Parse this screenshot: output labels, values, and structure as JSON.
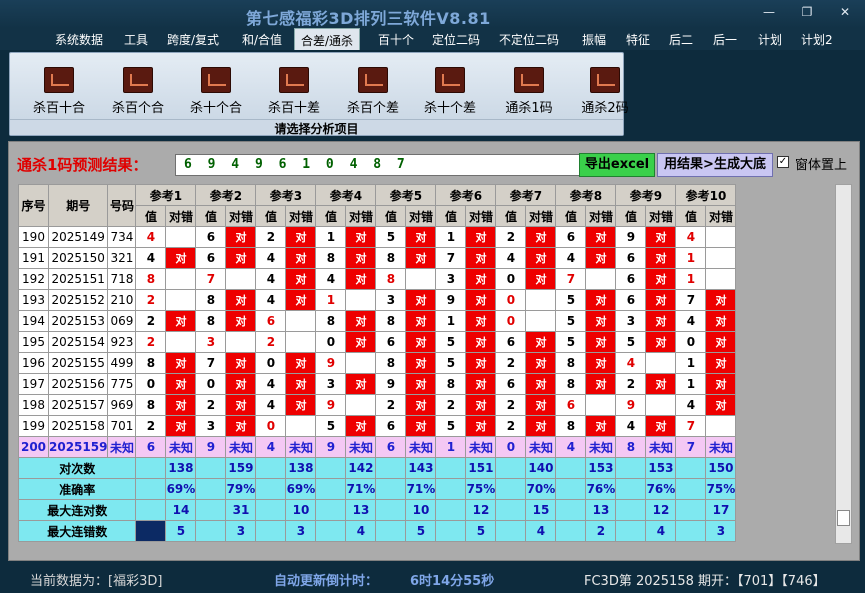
{
  "window": {
    "title": "第七感福彩3D排列三软件V8.81"
  },
  "menu": [
    "系统数据",
    "工具",
    "跨度/复式",
    "和/合值",
    "合差/通杀",
    "百十个",
    "定位二码",
    "不定位二码",
    "振幅",
    "特征",
    "后二",
    "后一",
    "计划",
    "计划2"
  ],
  "menu_active": 4,
  "ribbon": {
    "caption": "请选择分析项目",
    "buttons": [
      "杀百十合",
      "杀百个合",
      "杀十个合",
      "杀百十差",
      "杀百个差",
      "杀十个差",
      "通杀1码",
      "通杀2码"
    ]
  },
  "prediction": {
    "label": "通杀1码预测结果：",
    "value": "6 9 4 9 6 1 0 4 8 7",
    "export_label": "导出excel",
    "compound_label": "用结果>生成大底",
    "ontop_label": "窗体置上",
    "ontop_checked": "✓"
  },
  "table": {
    "headers": {
      "seq": "序号",
      "issue": "期号",
      "code": "号码",
      "ref_prefix": "参考",
      "val": "值",
      "hit": "对错"
    },
    "refs": [
      "参考1",
      "参考2",
      "参考3",
      "参考4",
      "参考5",
      "参考6",
      "参考7",
      "参考8",
      "参考9",
      "参考10"
    ],
    "rows": [
      {
        "seq": "190",
        "issue": "2025149",
        "code": "734",
        "cells": [
          [
            "4",
            "",
            1
          ],
          [
            "6",
            "对",
            0
          ],
          [
            "2",
            "对",
            0
          ],
          [
            "1",
            "对",
            0
          ],
          [
            "5",
            "对",
            0
          ],
          [
            "1",
            "对",
            0
          ],
          [
            "2",
            "对",
            0
          ],
          [
            "6",
            "对",
            0
          ],
          [
            "9",
            "对",
            0
          ],
          [
            "4",
            "",
            1
          ]
        ]
      },
      {
        "seq": "191",
        "issue": "2025150",
        "code": "321",
        "cells": [
          [
            "4",
            "对",
            0
          ],
          [
            "6",
            "对",
            0
          ],
          [
            "4",
            "对",
            0
          ],
          [
            "8",
            "对",
            0
          ],
          [
            "8",
            "对",
            0
          ],
          [
            "7",
            "对",
            0
          ],
          [
            "4",
            "对",
            0
          ],
          [
            "4",
            "对",
            0
          ],
          [
            "6",
            "对",
            0
          ],
          [
            "1",
            "",
            1
          ]
        ]
      },
      {
        "seq": "192",
        "issue": "2025151",
        "code": "718",
        "cells": [
          [
            "8",
            "",
            1
          ],
          [
            "7",
            "",
            1
          ],
          [
            "4",
            "对",
            0
          ],
          [
            "4",
            "对",
            0
          ],
          [
            "8",
            "",
            1
          ],
          [
            "3",
            "对",
            0
          ],
          [
            "0",
            "对",
            0
          ],
          [
            "7",
            "",
            1
          ],
          [
            "6",
            "对",
            0
          ],
          [
            "1",
            "",
            1
          ]
        ]
      },
      {
        "seq": "193",
        "issue": "2025152",
        "code": "210",
        "cells": [
          [
            "2",
            "",
            1
          ],
          [
            "8",
            "对",
            0
          ],
          [
            "4",
            "对",
            0
          ],
          [
            "1",
            "",
            1
          ],
          [
            "3",
            "对",
            0
          ],
          [
            "9",
            "对",
            0
          ],
          [
            "0",
            "",
            1
          ],
          [
            "5",
            "对",
            0
          ],
          [
            "6",
            "对",
            0
          ],
          [
            "7",
            "对",
            0
          ]
        ]
      },
      {
        "seq": "194",
        "issue": "2025153",
        "code": "069",
        "cells": [
          [
            "2",
            "对",
            0
          ],
          [
            "8",
            "对",
            0
          ],
          [
            "6",
            "",
            1
          ],
          [
            "8",
            "对",
            0
          ],
          [
            "8",
            "对",
            0
          ],
          [
            "1",
            "对",
            0
          ],
          [
            "0",
            "",
            1
          ],
          [
            "5",
            "对",
            0
          ],
          [
            "3",
            "对",
            0
          ],
          [
            "4",
            "对",
            0
          ]
        ]
      },
      {
        "seq": "195",
        "issue": "2025154",
        "code": "923",
        "cells": [
          [
            "2",
            "",
            1
          ],
          [
            "3",
            "",
            1
          ],
          [
            "2",
            "",
            1
          ],
          [
            "0",
            "对",
            0
          ],
          [
            "6",
            "对",
            0
          ],
          [
            "5",
            "对",
            0
          ],
          [
            "6",
            "对",
            0
          ],
          [
            "5",
            "对",
            0
          ],
          [
            "5",
            "对",
            0
          ],
          [
            "0",
            "对",
            0
          ]
        ]
      },
      {
        "seq": "196",
        "issue": "2025155",
        "code": "499",
        "cells": [
          [
            "8",
            "对",
            0
          ],
          [
            "7",
            "对",
            0
          ],
          [
            "0",
            "对",
            0
          ],
          [
            "9",
            "",
            1
          ],
          [
            "8",
            "对",
            0
          ],
          [
            "5",
            "对",
            0
          ],
          [
            "2",
            "对",
            0
          ],
          [
            "8",
            "对",
            0
          ],
          [
            "4",
            "",
            1
          ],
          [
            "1",
            "对",
            0
          ]
        ]
      },
      {
        "seq": "197",
        "issue": "2025156",
        "code": "775",
        "cells": [
          [
            "0",
            "对",
            0
          ],
          [
            "0",
            "对",
            0
          ],
          [
            "4",
            "对",
            0
          ],
          [
            "3",
            "对",
            0
          ],
          [
            "9",
            "对",
            0
          ],
          [
            "8",
            "对",
            0
          ],
          [
            "6",
            "对",
            0
          ],
          [
            "8",
            "对",
            0
          ],
          [
            "2",
            "对",
            0
          ],
          [
            "1",
            "对",
            0
          ]
        ]
      },
      {
        "seq": "198",
        "issue": "2025157",
        "code": "969",
        "cells": [
          [
            "8",
            "对",
            0
          ],
          [
            "2",
            "对",
            0
          ],
          [
            "4",
            "对",
            0
          ],
          [
            "9",
            "",
            1
          ],
          [
            "2",
            "对",
            0
          ],
          [
            "2",
            "对",
            0
          ],
          [
            "2",
            "对",
            0
          ],
          [
            "6",
            "",
            1
          ],
          [
            "9",
            "",
            1
          ],
          [
            "4",
            "对",
            0
          ]
        ]
      },
      {
        "seq": "199",
        "issue": "2025158",
        "code": "701",
        "cells": [
          [
            "2",
            "对",
            0
          ],
          [
            "3",
            "对",
            0
          ],
          [
            "0",
            "",
            1
          ],
          [
            "5",
            "对",
            0
          ],
          [
            "6",
            "对",
            0
          ],
          [
            "5",
            "对",
            0
          ],
          [
            "2",
            "对",
            0
          ],
          [
            "8",
            "对",
            0
          ],
          [
            "4",
            "对",
            0
          ],
          [
            "7",
            "",
            1
          ]
        ]
      }
    ],
    "pending": {
      "seq": "200",
      "issue": "2025159",
      "code": "未知",
      "values": [
        "6",
        "9",
        "4",
        "9",
        "6",
        "1",
        "0",
        "4",
        "8",
        "7"
      ],
      "status": "未知"
    },
    "stats": [
      {
        "label": "对次数",
        "values": [
          "138",
          "159",
          "138",
          "142",
          "143",
          "151",
          "140",
          "153",
          "153",
          "150"
        ]
      },
      {
        "label": "准确率",
        "values": [
          "69%",
          "79%",
          "69%",
          "71%",
          "71%",
          "75%",
          "70%",
          "76%",
          "76%",
          "75%"
        ]
      },
      {
        "label": "最大连对数",
        "values": [
          "14",
          "31",
          "10",
          "13",
          "10",
          "12",
          "15",
          "13",
          "12",
          "17"
        ]
      },
      {
        "label": "最大连错数",
        "values": [
          "5",
          "3",
          "3",
          "4",
          "5",
          "5",
          "4",
          "2",
          "4",
          "3"
        ]
      }
    ]
  },
  "status": {
    "current": "当前数据为：[福彩3D]",
    "countdown_label": "自动更新倒计时：",
    "countdown": "6时14分55秒",
    "draw": "FC3D第 2025158 期开：【701】【746】"
  },
  "colors": {
    "hit_red": "#ee0000",
    "stat_cyan": "#7ee8f0",
    "pending_pink": "#f4c8f4"
  }
}
